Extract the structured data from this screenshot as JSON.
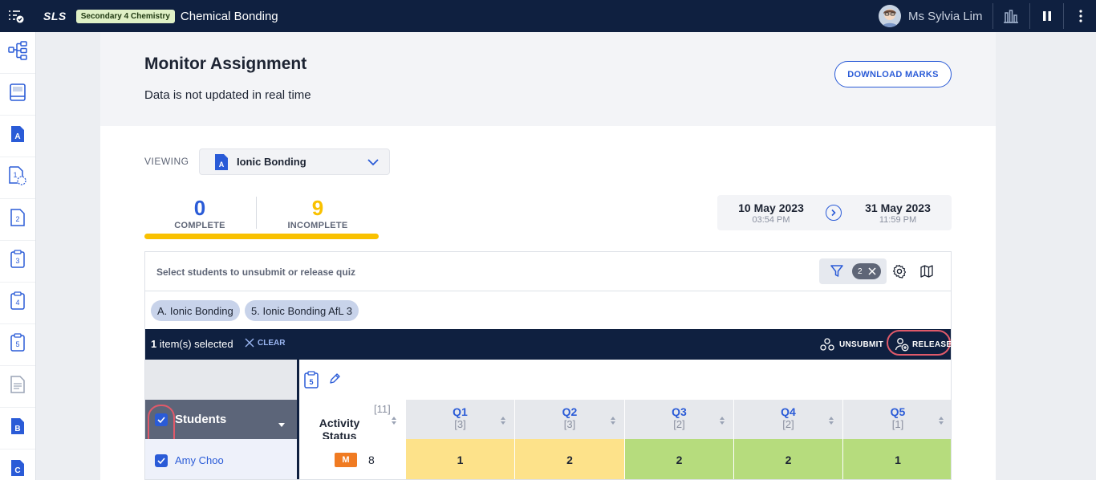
{
  "topbar": {
    "logo": "SLS",
    "subject_badge": "Secondary 4 Chemistry",
    "lesson_title": "Chemical Bonding",
    "user_name": "Ms Sylvia Lim"
  },
  "sidebar": {
    "items": [
      {
        "icon": "lesson-map-icon"
      },
      {
        "icon": "book-icon"
      },
      {
        "icon": "section-a-icon",
        "letter": "A"
      },
      {
        "icon": "activity-1-icon",
        "letter": "1"
      },
      {
        "icon": "activity-2-icon",
        "letter": "2"
      },
      {
        "icon": "activity-3-icon",
        "letter": "3"
      },
      {
        "icon": "activity-4-icon",
        "letter": "4"
      },
      {
        "icon": "activity-5-icon",
        "letter": "5"
      },
      {
        "icon": "document-icon"
      },
      {
        "icon": "section-b-icon",
        "letter": "B"
      },
      {
        "icon": "section-c-icon",
        "letter": "C"
      }
    ]
  },
  "header": {
    "title": "Monitor Assignment",
    "subtitle": "Data is not updated in real time",
    "download_label": "DOWNLOAD MARKS"
  },
  "viewing": {
    "label": "VIEWING",
    "section_letter": "A",
    "selected": "Ionic Bonding"
  },
  "stats": {
    "complete_value": "0",
    "complete_label": "COMPLETE",
    "incomplete_value": "9",
    "incomplete_label": "INCOMPLETE",
    "complete_fraction": 0
  },
  "dates": {
    "start_date": "10 May 2023",
    "start_time": "03:54 PM",
    "end_date": "31 May 2023",
    "end_time": "11:59 PM"
  },
  "table": {
    "hint": "Select students to unsubmit or release quiz",
    "filter_count": "2",
    "tags": [
      "A. Ionic Bonding",
      "5. Ionic Bonding AfL 3"
    ],
    "selection": {
      "count": "1",
      "text": " item(s) selected",
      "clear_label": "CLEAR",
      "unsubmit_label": "UNSUBMIT",
      "release_label": "RELEASE"
    },
    "toolbar_quiz_number": "5",
    "students_header": "Students",
    "activity_header": "Activity Status",
    "activity_total": "[11]",
    "questions": [
      {
        "label": "Q1",
        "marks": "[3]"
      },
      {
        "label": "Q2",
        "marks": "[3]"
      },
      {
        "label": "Q3",
        "marks": "[2]"
      },
      {
        "label": "Q4",
        "marks": "[2]"
      },
      {
        "label": "Q5",
        "marks": "[1]"
      }
    ],
    "rows": [
      {
        "name": "Amy Choo",
        "status_badge": "M",
        "score": "8",
        "scores": [
          "1",
          "2",
          "2",
          "2",
          "1"
        ]
      }
    ]
  },
  "colors": {
    "topbar": "#0f2040",
    "accent": "#2a5bd7",
    "incomplete": "#f9c100",
    "partial_cell": "#fde28a",
    "full_cell": "#b6dc7d",
    "highlight_ring": "#e05a6a",
    "status_badge": "#f07b22"
  }
}
